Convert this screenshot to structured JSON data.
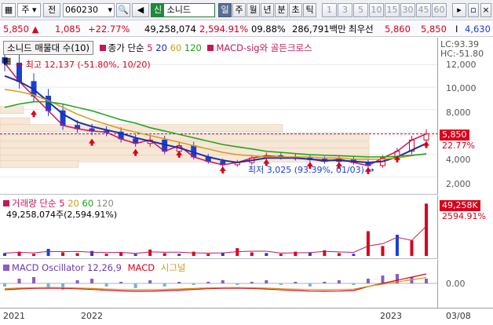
{
  "toolbar": {
    "market": "주",
    "market_type": "전",
    "code": "060230",
    "badge": "신",
    "stock_name": "소니드",
    "periods": [
      "일",
      "주",
      "월",
      "년",
      "분",
      "초",
      "틱"
    ],
    "active_period": "일",
    "minutes": [
      "1",
      "3",
      "5",
      "10",
      "15",
      "30",
      "45",
      "60"
    ],
    "icons": [
      "dropdown-icon",
      "search-icon",
      "speaker-icon",
      "menu-icon",
      "window-icon"
    ]
  },
  "quote": {
    "price": "5,850",
    "direction": "▲",
    "change": "1,085",
    "change_pct": "+22.77%",
    "volume": "49,258,074",
    "volume_pct": "2,594.91%",
    "turnover_pct": "09.88%",
    "amount": "286,791백만",
    "label_best_seller": "최우선",
    "ask": "5,860",
    "bid": "5,850",
    "lot_label": "I",
    "lot_value": "4,630"
  },
  "price_panel": {
    "title": "소니드 매물대 수(10)",
    "ma_label": "종가 단순",
    "ma_periods": [
      "5",
      "20",
      "60",
      "120"
    ],
    "ma_colors": [
      "#d2105e",
      "#1d2fa6",
      "#d69a1a",
      "#19a319"
    ],
    "macd_sig_label": "MACD-sig와 골든크로스",
    "high_annotation": "최고 12,137 (-51.80%, 10/20)",
    "low_annotation": "최저 3,025 (93.39%, 01/03)",
    "lc": "LC:93.39",
    "hc": "HC:-51.80",
    "y_ticks": [
      "12,000",
      "10,000",
      "8,000",
      "6,000",
      "4,000",
      "2,000"
    ],
    "current_price_tag": "5,850",
    "current_pct_tag": "22.77%"
  },
  "volume_panel": {
    "title": "거래량",
    "ma_label": "단순",
    "ma_periods": [
      "5",
      "20",
      "60",
      "120"
    ],
    "volume_text": "49,258,074주(2,594.91%)",
    "volume_tag": "49,258K",
    "volume_pct_tag": "2594.91%"
  },
  "macd_panel": {
    "title": "MACD Oscillator 12,26,9",
    "macd_label": "MACD",
    "signal_label": "시그널",
    "zero_tick": "0.00"
  },
  "x_axis": {
    "labels": [
      "2021",
      "2022",
      "2023",
      "03/08"
    ]
  },
  "chart_data": {
    "type": "line",
    "x_range": [
      "2021",
      "03/08"
    ],
    "y_range": [
      1000,
      13000
    ],
    "series": [
      {
        "name": "종가",
        "values": [
          12137,
          10500,
          9200,
          7900,
          6600,
          6300,
          6100,
          6000,
          5400,
          5000,
          5300,
          4300,
          4800,
          3800,
          3400,
          3100,
          3300,
          3700,
          3900,
          3800,
          3700,
          3600,
          3400,
          3600,
          3300,
          3025,
          3700,
          4300,
          5300,
          5850
        ]
      },
      {
        "name": "5",
        "values": [
          12137,
          10500,
          9200,
          7900,
          6600,
          6300,
          6100,
          6000,
          5400,
          5000,
          5300,
          4300,
          4800,
          3800,
          3400,
          3100,
          3300,
          3700,
          3900,
          3800,
          3700,
          3600,
          3400,
          3600,
          3300,
          3025,
          3700,
          4300,
          5300,
          5850
        ]
      },
      {
        "name": "20",
        "values": [
          11000,
          10500,
          9800,
          8700,
          7600,
          6900,
          6500,
          6200,
          5900,
          5500,
          5200,
          4900,
          4600,
          4200,
          3800,
          3500,
          3300,
          3500,
          3700,
          3700,
          3700,
          3600,
          3500,
          3500,
          3400,
          3300,
          3400,
          3800,
          4400,
          5000
        ]
      },
      {
        "name": "60",
        "values": [
          9800,
          9600,
          9300,
          8800,
          8200,
          7600,
          7100,
          6700,
          6300,
          6000,
          5700,
          5400,
          5100,
          4800,
          4500,
          4200,
          4000,
          3900,
          3800,
          3800,
          3800,
          3800,
          3700,
          3700,
          3600,
          3600,
          3600,
          3700,
          3900,
          4100
        ]
      },
      {
        "name": "120",
        "values": [
          8200,
          8500,
          8700,
          8700,
          8500,
          8200,
          7900,
          7500,
          7100,
          6800,
          6400,
          6100,
          5800,
          5500,
          5200,
          4900,
          4700,
          4500,
          4300,
          4200,
          4100,
          4000,
          3950,
          3900,
          3850,
          3800,
          3800,
          3850,
          3950,
          4050
        ]
      }
    ]
  }
}
